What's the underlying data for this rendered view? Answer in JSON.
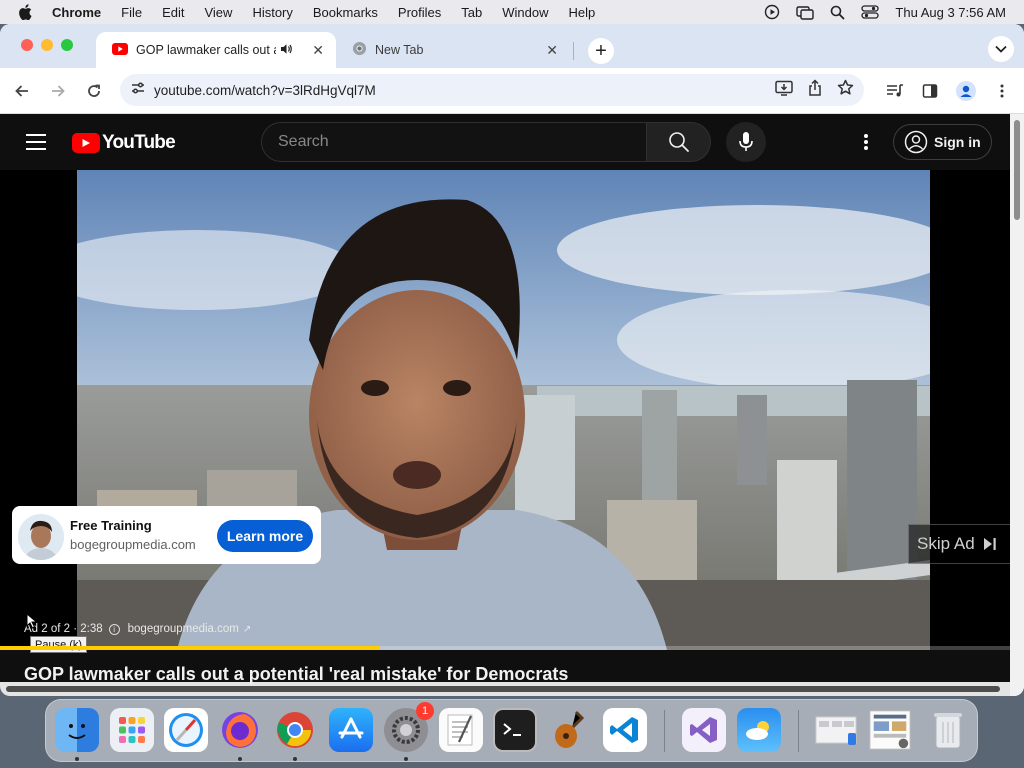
{
  "menubar": {
    "app_name": "Chrome",
    "items": [
      "File",
      "Edit",
      "View",
      "History",
      "Bookmarks",
      "Profiles",
      "Tab",
      "Window",
      "Help"
    ],
    "datetime": "Thu Aug 3  7:56 AM"
  },
  "browser": {
    "tabs": [
      {
        "title": "GOP lawmaker calls out a",
        "active": true
      },
      {
        "title": "New Tab",
        "active": false
      }
    ],
    "url": "youtube.com/watch?v=3lRdHgVql7M"
  },
  "youtube": {
    "logo_text": "YouTube",
    "search_placeholder": "Search",
    "sign_in_label": "Sign in",
    "ad": {
      "card_title": "Free Training",
      "card_domain": "bogegroupmedia.com",
      "cta_label": "Learn more",
      "skip_label": "Skip Ad",
      "ad_counter": "Ad 2 of 2 · 2:38",
      "ad_domain": "bogegroupmedia.com",
      "progress_fraction": 0.375
    },
    "tooltip": "Pause (k)",
    "video_title": "GOP lawmaker calls out a potential 'real mistake' for Democrats"
  },
  "dock": {
    "apps": [
      "Finder",
      "Launchpad",
      "Safari",
      "Firefox",
      "Google Chrome",
      "App Store",
      "System Settings",
      "TextEdit",
      "Terminal",
      "Instruments",
      "Visual Studio Code",
      "Visual Studio",
      "Weather",
      "Screenshot",
      "Preview",
      "Trash"
    ],
    "settings_badge": "1"
  },
  "colors": {
    "youtube_red": "#ff0000",
    "ad_progress": "#ffcc00",
    "cta_blue": "#065fd4",
    "page_bg": "#0f0f0f"
  }
}
